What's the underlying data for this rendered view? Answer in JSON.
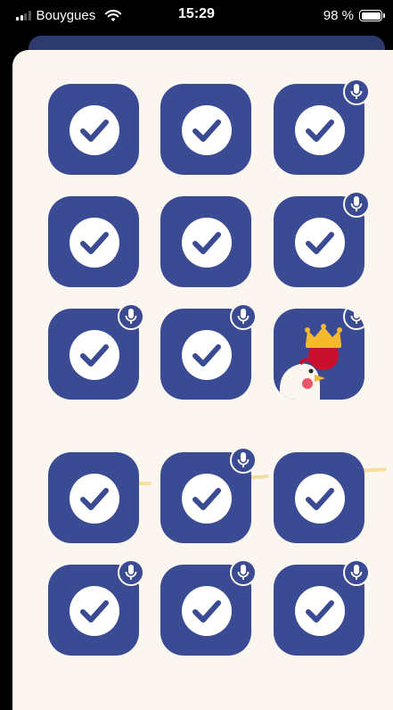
{
  "status_bar": {
    "carrier": "Bouygues",
    "time": "15:29",
    "battery": "98 %"
  },
  "colors": {
    "tile": "#3a4b93",
    "background": "#fbf6ef",
    "divider": "#f5dea0"
  },
  "levels": [
    {
      "state": "completed",
      "mic": false
    },
    {
      "state": "completed",
      "mic": false
    },
    {
      "state": "completed",
      "mic": true
    },
    {
      "state": "completed",
      "mic": false
    },
    {
      "state": "completed",
      "mic": false
    },
    {
      "state": "completed",
      "mic": true
    },
    {
      "state": "completed",
      "mic": true
    },
    {
      "state": "completed",
      "mic": true
    },
    {
      "state": "boss-chicken",
      "mic": true
    },
    {
      "state": "completed",
      "mic": false
    },
    {
      "state": "completed",
      "mic": true
    },
    {
      "state": "completed",
      "mic": false
    },
    {
      "state": "completed",
      "mic": true
    },
    {
      "state": "completed",
      "mic": true
    },
    {
      "state": "completed",
      "mic": true
    }
  ]
}
